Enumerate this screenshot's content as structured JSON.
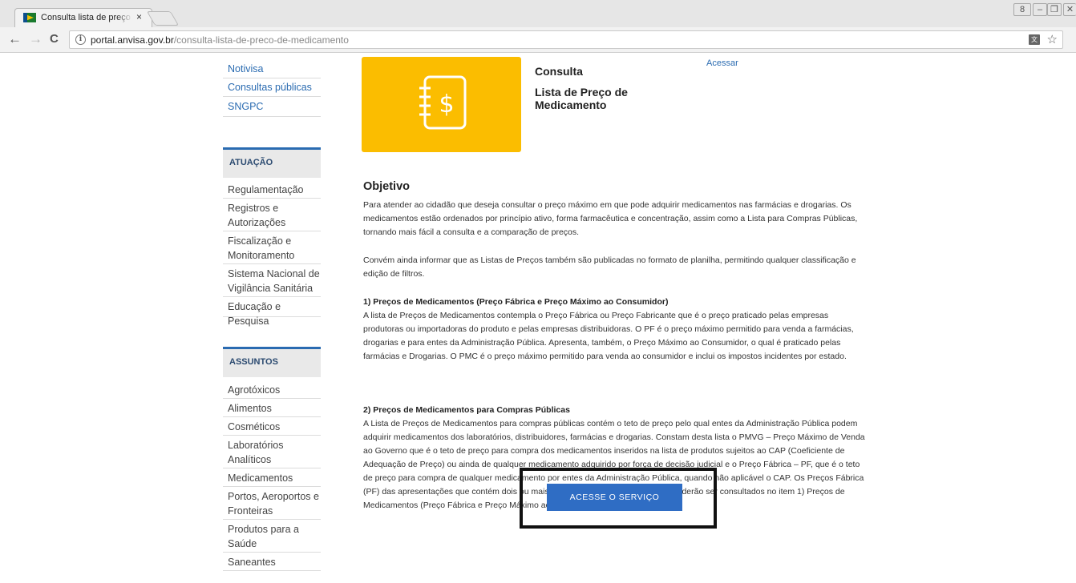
{
  "browser": {
    "tab_title": "Consulta lista de preço d",
    "tab_close": "×",
    "url_host": "portal.anvisa.gov.br",
    "url_path": "/consulta-lista-de-preco-de-medicamento",
    "info_glyph": "i",
    "back_glyph": "←",
    "forward_glyph": "→",
    "reload_glyph": "C",
    "star_glyph": "☆",
    "translate_glyph": "文",
    "window_controls": [
      "8",
      "–",
      "❐",
      "✕"
    ]
  },
  "sidebar": {
    "top_links": [
      "Notivisa",
      "Consultas públicas",
      "SNGPC"
    ],
    "atuacao_heading": "ATUAÇÃO",
    "atuacao_items": [
      "Regulamentação",
      "Registros e Autorizações",
      "Fiscalização e Monitoramento",
      "Sistema Nacional de Vigilância Sanitária",
      "Educação e Pesquisa"
    ],
    "assuntos_heading": "ASSUNTOS",
    "assuntos_items": [
      "Agrotóxicos",
      "Alimentos",
      "Cosméticos",
      "Laboratórios Analíticos",
      "Medicamentos",
      "Portos, Aeroportos e Fronteiras",
      "Produtos para a Saúde",
      "Saneantes"
    ]
  },
  "content": {
    "consulta_label": "Consulta",
    "subtitle": "Lista de Preço de Medicamento",
    "acessar_link": "Acessar",
    "objetivo_heading": "Objetivo",
    "paragraph_1": "Para atender ao cidadão que deseja consultar o preço máximo em que pode adquirir medicamentos nas farmácias e drogarias. Os medicamentos estão ordenados por princípio ativo, forma farmacêutica e concentração, assim como a Lista para Compras Públicas, tornando mais fácil a consulta e a comparação de preços.",
    "paragraph_2": "Convém ainda informar que as Listas de Preços também são publicadas no formato de planilha, permitindo qualquer classificação e edição de filtros.",
    "section_1_title": "1) Preços de Medicamentos (Preço Fábrica e Preço Máximo ao Consumidor)",
    "section_1_text": "A lista de Preços de Medicamentos contempla o Preço Fábrica ou Preço Fabricante que é o preço praticado pelas empresas produtoras ou importadoras do produto e pelas empresas distribuidoras. O PF é o preço máximo permitido para venda a farmácias, drogarias e para entes da Administração Pública. Apresenta, também, o Preço Máximo ao Consumidor, o qual é praticado pelas farmácias e Drogarias. O PMC é o preço máximo permitido para venda ao consumidor e inclui os impostos incidentes por estado.",
    "section_2_title": "2) Preços de Medicamentos para Compras Públicas",
    "section_2_text": "A Lista de Preços de Medicamentos para compras públicas contém o teto de preço pelo qual entes da Administração Pública podem adquirir medicamentos dos laboratórios, distribuidores, farmácias e drogarias. Constam desta lista o  PMVG – Preço Máximo de Venda ao Governo que é o teto de preço para compra dos medicamentos inseridos na lista de produtos sujeitos ao CAP (Coeficiente de Adequação de Preço) ou ainda de qualquer medicamento adquirido por força de decisão judicial e o Preço Fábrica – PF, que é o teto de preço para compra de qualquer medicamento por entes da Administração Pública, quando não aplicável o CAP. Os Preços Fábrica (PF) das apresentações que contém dois ou mais princípios ativos em associação poderão ser consultados no item 1) Preços de Medicamentos (Preço Fábrica e Preço Máximo ao Consumidor).",
    "cta_label": "ACESSE O SERVIÇO",
    "hero_icon": "price-list-notebook-icon"
  },
  "colors": {
    "hero_yellow": "#fbbd00",
    "link_blue": "#2a6bb1",
    "cta_blue": "#2f6dc4"
  }
}
